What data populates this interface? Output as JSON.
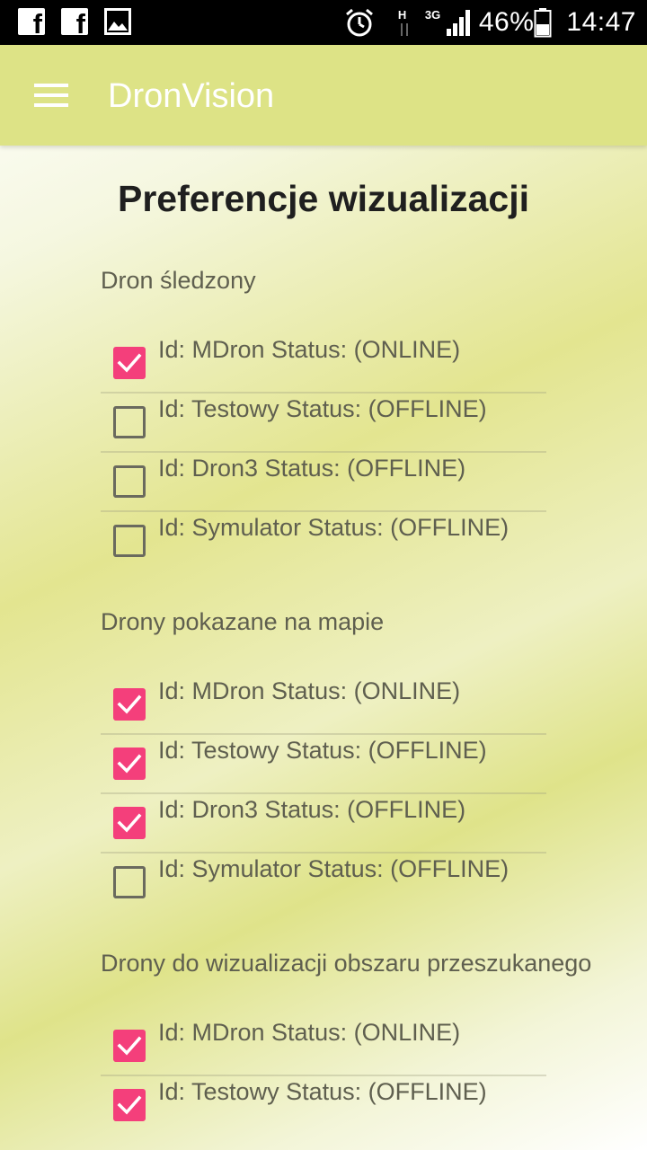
{
  "status_bar": {
    "battery": "46%",
    "time": "14:47",
    "network": "3G",
    "h_indicator": "H"
  },
  "app_bar": {
    "title": "DronVision"
  },
  "page": {
    "title": "Preferencje wizualizacji"
  },
  "sections": [
    {
      "title": "Dron śledzony",
      "items": [
        {
          "label": "Id: MDron Status: (ONLINE)",
          "checked": true
        },
        {
          "label": "Id: Testowy Status: (OFFLINE)",
          "checked": false
        },
        {
          "label": "Id: Dron3 Status: (OFFLINE)",
          "checked": false
        },
        {
          "label": "Id: Symulator Status: (OFFLINE)",
          "checked": false
        }
      ]
    },
    {
      "title": "Drony pokazane na mapie",
      "items": [
        {
          "label": "Id: MDron Status: (ONLINE)",
          "checked": true
        },
        {
          "label": "Id: Testowy Status: (OFFLINE)",
          "checked": true
        },
        {
          "label": "Id: Dron3 Status: (OFFLINE)",
          "checked": true
        },
        {
          "label": "Id: Symulator Status: (OFFLINE)",
          "checked": false
        }
      ]
    },
    {
      "title": "Drony do wizualizacji obszaru przeszukanego",
      "items": [
        {
          "label": "Id: MDron Status: (ONLINE)",
          "checked": true
        },
        {
          "label": "Id: Testowy Status: (OFFLINE)",
          "checked": true
        }
      ]
    }
  ],
  "colors": {
    "app_bar": "#dde386",
    "checkbox_checked": "#f43f7b",
    "checkbox_unchecked_border": "#6a6a5e",
    "text": "#5f5f4f",
    "title_text": "#1f1f1f"
  },
  "icons": {
    "status_left": [
      "facebook-icon",
      "facebook-icon",
      "image-icon"
    ],
    "status_right": [
      "alarm-icon",
      "data-arrows-icon",
      "signal-icon",
      "battery-icon"
    ],
    "app_bar": "hamburger-menu-icon",
    "checkmark": "checkmark-icon"
  }
}
